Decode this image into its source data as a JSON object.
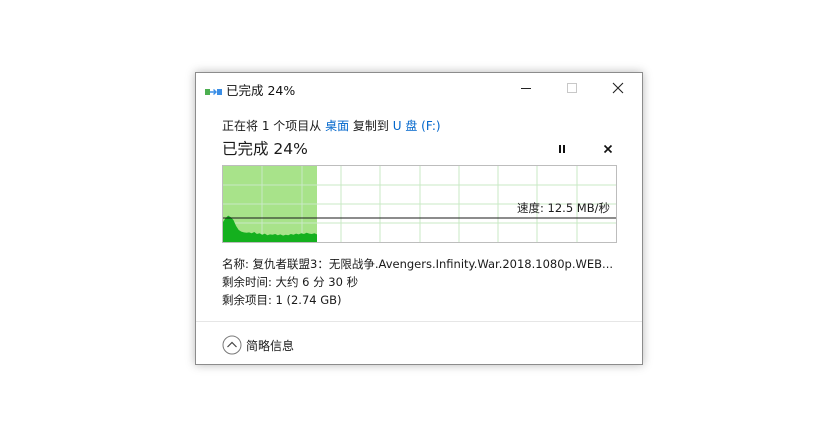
{
  "window": {
    "title": "已完成 24%"
  },
  "operation": {
    "prefix": "正在将 1 个项目从 ",
    "source": "桌面",
    "middle": " 复制到 ",
    "destination": "U 盘 (F:)"
  },
  "progress": {
    "label": "已完成 24%",
    "percent": 24
  },
  "graph": {
    "speed_text": "速度: 12.5 MB/秒",
    "fill_color": "#a8e38a",
    "plot_color": "#14b01e",
    "grid_color": "#c9eac4"
  },
  "details": {
    "name_text": "名称: 复仇者联盟3：无限战争.Avengers.Infinity.War.2018.1080p.WEB...",
    "time_text": "剩余时间: 大约 6 分 30 秒",
    "items_text": "剩余项目: 1 (2.74 GB)"
  },
  "footer": {
    "collapse_label": "简略信息"
  },
  "icons": {
    "app": "copy-transfer-icon",
    "minimize": "minimize-icon",
    "maximize": "maximize-icon",
    "close": "close-icon",
    "pause": "pause-icon",
    "cancel": "cancel-icon",
    "collapse": "chevron-up-icon"
  }
}
